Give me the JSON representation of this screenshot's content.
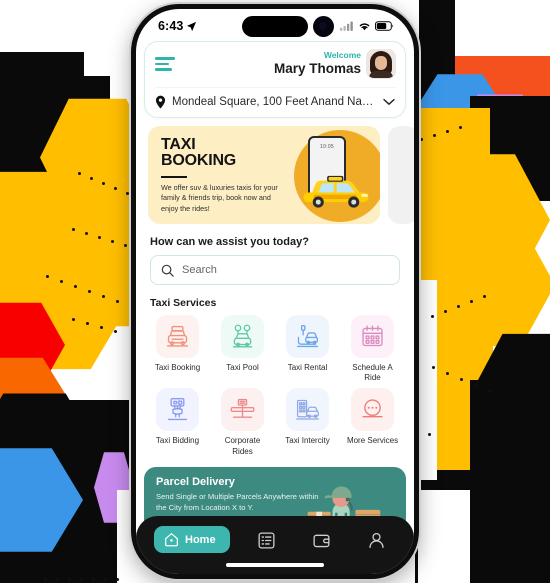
{
  "background": {
    "palette": {
      "black": "#0a0a0a",
      "amber": "#ffbf00",
      "orange": "#f96800",
      "orange_red": "#f4511e",
      "red": "#f80000",
      "blue": "#3b96e8",
      "purple": "#c78bee",
      "white": "#ffffff"
    }
  },
  "statusbar": {
    "time": "6:43",
    "location_arrow_icon": "location-arrow-icon",
    "signal_icon": "cellular-signal-icon",
    "wifi_icon": "wifi-icon",
    "battery_icon": "battery-icon"
  },
  "header": {
    "menu_icon": "hamburger-menu-icon",
    "welcome_label": "Welcome",
    "user_name": "Mary Thomas",
    "avatar_icon": "user-avatar",
    "location_pin_icon": "location-pin-icon",
    "location_text": "Mondeal Square, 100 Feet Anand Naga...",
    "location_chevron_icon": "chevron-down-icon"
  },
  "banner": {
    "title_line1": "TAXI",
    "title_line2": "BOOKING",
    "description": "We offer suv & luxuries taxis for your family & friends trip, book now and enjoy the rides!",
    "phone_mock_time": "10:05",
    "car_icon": "yellow-taxi-car",
    "accent_circle_color": "#f0ac26",
    "card_bg_color": "#fdeec4"
  },
  "assist": {
    "heading": "How can we assist you today?",
    "search_placeholder": "Search",
    "search_icon": "search-icon"
  },
  "services": {
    "heading": "Taxi Services",
    "items": [
      {
        "label": "Taxi Booking",
        "icon": "taxi-front-icon",
        "color": "#f2907c",
        "bg": "#fdf2ef"
      },
      {
        "label": "Taxi Pool",
        "icon": "taxi-pool-icon",
        "color": "#5fc9a5",
        "bg": "#eefaf5"
      },
      {
        "label": "Taxi Rental",
        "icon": "taxi-rental-hand-icon",
        "color": "#6fa8e8",
        "bg": "#eff5fd"
      },
      {
        "label": "Schedule A Ride",
        "icon": "calendar-icon",
        "color": "#d98cc0",
        "bg": "#fdf0f8"
      },
      {
        "label": "Taxi Bidding",
        "icon": "bid-hand-icon",
        "color": "#8a9cf0",
        "bg": "#f1f3fe"
      },
      {
        "label": "Corporate Rides",
        "icon": "corporate-taxi-icon",
        "color": "#f08a8a",
        "bg": "#fdf0f0"
      },
      {
        "label": "Taxi Intercity",
        "icon": "intercity-building-icon",
        "color": "#8fa8e8",
        "bg": "#f1f5fd"
      },
      {
        "label": "More Services",
        "icon": "more-dots-icon",
        "color": "#ef7a7a",
        "bg": "#fdf0ef"
      }
    ]
  },
  "parcel": {
    "title": "Parcel Delivery",
    "description": "Send Single or Multiple Parcels Anywhere within the City from Location X to Y.",
    "courier_icon": "delivery-person-icon",
    "bg_color": "#3d8a80"
  },
  "bottom_nav": {
    "active_color": "#3cb6ae",
    "items": [
      {
        "label": "Home",
        "icon": "home-icon",
        "active": true
      },
      {
        "label": "",
        "icon": "list-icon",
        "active": false
      },
      {
        "label": "",
        "icon": "wallet-icon",
        "active": false
      },
      {
        "label": "",
        "icon": "person-icon",
        "active": false
      }
    ]
  }
}
